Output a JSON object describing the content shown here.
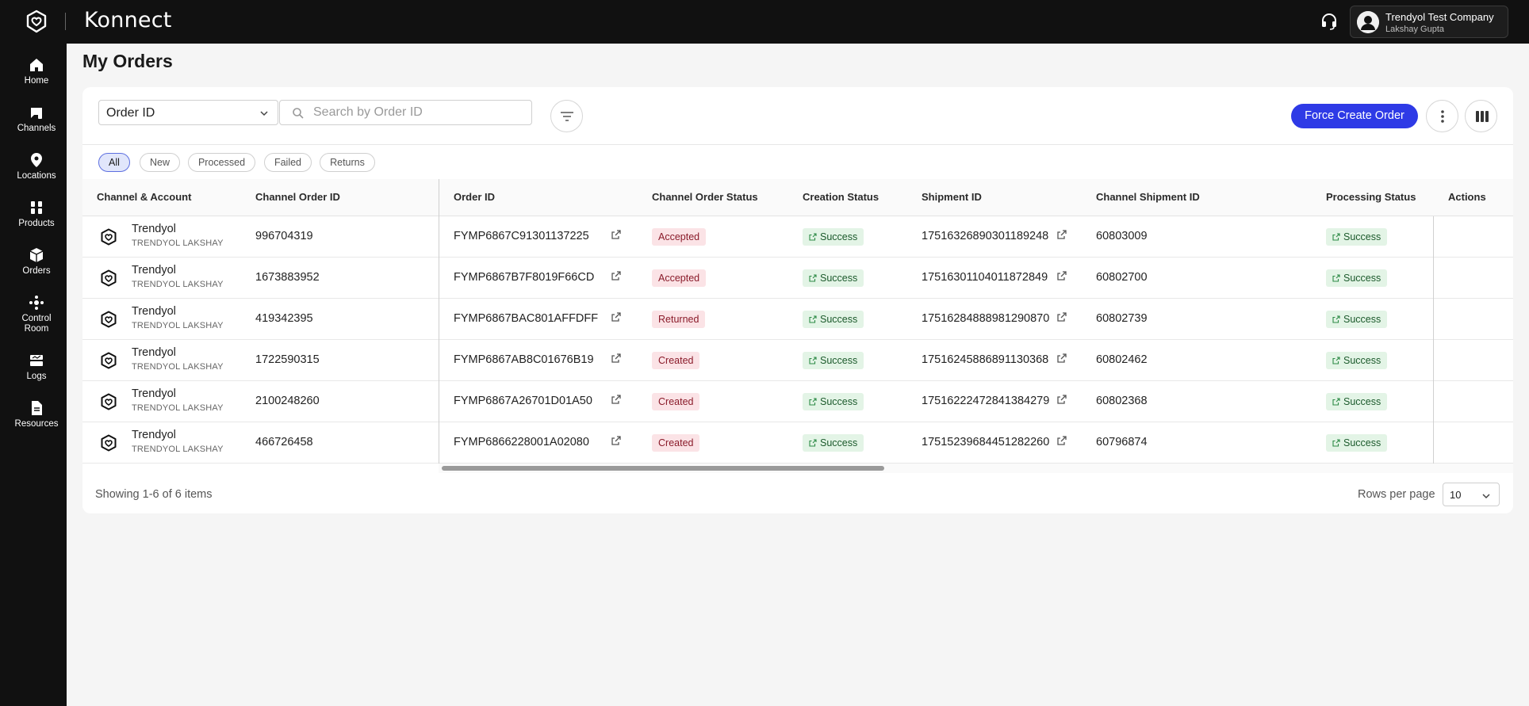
{
  "app": {
    "brand": "Konnect"
  },
  "account": {
    "company": "Trendyol Test Company",
    "user": "Lakshay Gupta"
  },
  "sidebar": {
    "items": [
      {
        "label": "Home",
        "icon": "home-icon"
      },
      {
        "label": "Channels",
        "icon": "channels-icon"
      },
      {
        "label": "Locations",
        "icon": "location-pin-icon"
      },
      {
        "label": "Products",
        "icon": "products-icon"
      },
      {
        "label": "Orders",
        "icon": "orders-box-icon"
      },
      {
        "label": "Control Room",
        "icon": "control-room-icon"
      },
      {
        "label": "Logs",
        "icon": "logs-icon"
      },
      {
        "label": "Resources",
        "icon": "document-icon"
      }
    ]
  },
  "page": {
    "title": "My Orders"
  },
  "toolbar": {
    "search_field": "Order ID",
    "search_placeholder": "Search by Order ID",
    "force_create_label": "Force Create Order"
  },
  "filters": {
    "chips": [
      "All",
      "New",
      "Processed",
      "Failed",
      "Returns"
    ],
    "active": "All"
  },
  "table": {
    "columns": [
      "Channel & Account",
      "Channel Order ID",
      "Order ID",
      "Channel Order Status",
      "Creation Status",
      "Shipment ID",
      "Channel Shipment ID",
      "Processing Status",
      "Actions"
    ],
    "rows": [
      {
        "channel": "Trendyol",
        "account": "TRENDYOL LAKSHAY",
        "channel_order_id": "996704319",
        "order_id": "FYMP6867C91301137225",
        "channel_order_status": "Accepted",
        "creation_status": "Success",
        "shipment_id": "17516326890301189248",
        "channel_shipment_id": "60803009",
        "processing_status": "Success"
      },
      {
        "channel": "Trendyol",
        "account": "TRENDYOL LAKSHAY",
        "channel_order_id": "1673883952",
        "order_id": "FYMP6867B7F8019F66CD",
        "channel_order_status": "Accepted",
        "creation_status": "Success",
        "shipment_id": "17516301104011872849",
        "channel_shipment_id": "60802700",
        "processing_status": "Success"
      },
      {
        "channel": "Trendyol",
        "account": "TRENDYOL LAKSHAY",
        "channel_order_id": "419342395",
        "order_id": "FYMP6867BAC801AFFDFF",
        "channel_order_status": "Returned",
        "creation_status": "Success",
        "shipment_id": "17516284888981290870",
        "channel_shipment_id": "60802739",
        "processing_status": "Success"
      },
      {
        "channel": "Trendyol",
        "account": "TRENDYOL LAKSHAY",
        "channel_order_id": "1722590315",
        "order_id": "FYMP6867AB8C01676B19",
        "channel_order_status": "Created",
        "creation_status": "Success",
        "shipment_id": "17516245886891130368",
        "channel_shipment_id": "60802462",
        "processing_status": "Success"
      },
      {
        "channel": "Trendyol",
        "account": "TRENDYOL LAKSHAY",
        "channel_order_id": "2100248260",
        "order_id": "FYMP6867A26701D01A50",
        "channel_order_status": "Created",
        "creation_status": "Success",
        "shipment_id": "17516222472841384279",
        "channel_shipment_id": "60802368",
        "processing_status": "Success"
      },
      {
        "channel": "Trendyol",
        "account": "TRENDYOL LAKSHAY",
        "channel_order_id": "466726458",
        "order_id": "FYMP6866228001A02080",
        "channel_order_status": "Created",
        "creation_status": "Success",
        "shipment_id": "17515239684451282260",
        "channel_shipment_id": "60796874",
        "processing_status": "Success"
      }
    ]
  },
  "footer": {
    "showing": "Showing 1-6 of 6 items",
    "rows_per_page_label": "Rows per page",
    "rows_per_page": "10"
  },
  "colors": {
    "primary": "#2e3ae6",
    "topbar": "#111111",
    "badge_red_bg": "#fbe3e6",
    "badge_green_bg": "#e3f4e6"
  }
}
